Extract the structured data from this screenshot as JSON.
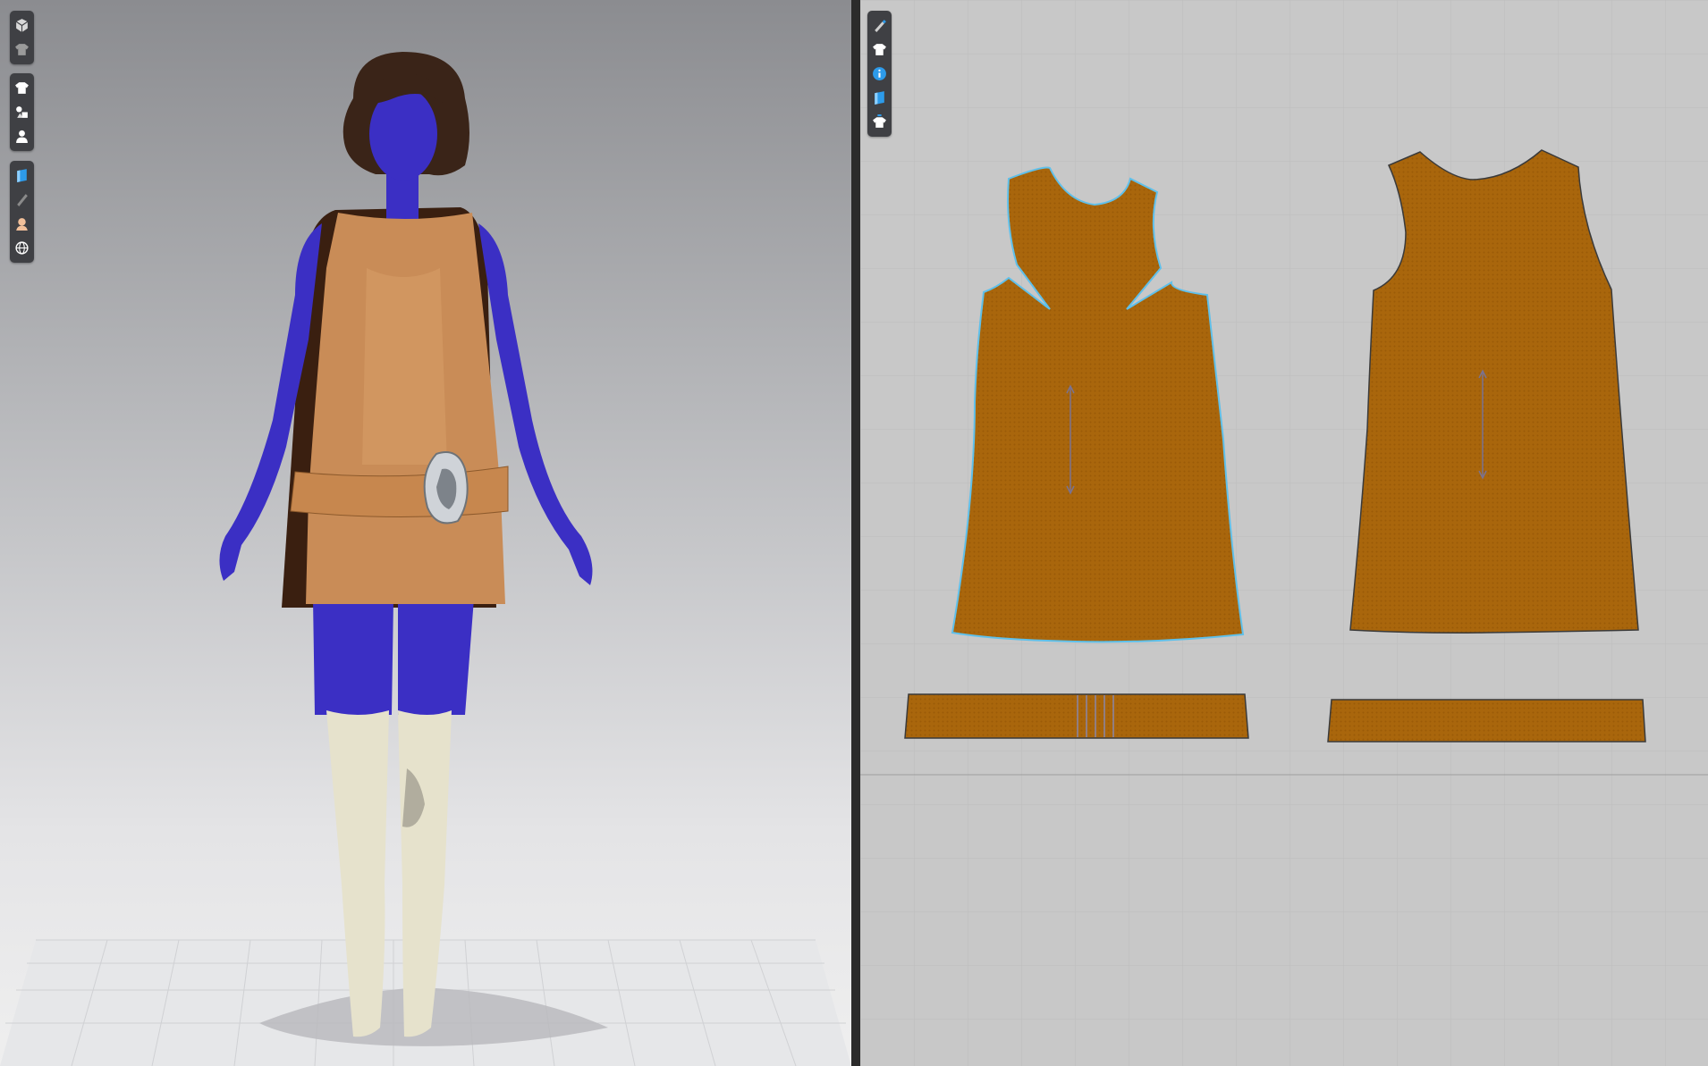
{
  "colors": {
    "fabric": "#a9660c",
    "fabric_3d": "#c98c57",
    "skin": "#3b2fc4",
    "boots": "#e6e2cc",
    "hair": "#3a2418",
    "buckle": "#cfd3d8",
    "seam_highlight": "#5fc0ea",
    "grid_floor": "#d9dadd",
    "toolbar_bg": "#3f4044"
  },
  "view3d_toolbar": {
    "groups": [
      [
        "cube-view-icon",
        "garment-hide-icon"
      ],
      [
        "shirt-icon",
        "shapes-icon",
        "avatar-icon"
      ],
      [
        "texture-icon",
        "ruler-icon",
        "skin-icon",
        "globe-icon"
      ]
    ]
  },
  "view2d_toolbar": {
    "tools": [
      "edit-pattern-icon",
      "shirt-icon",
      "info-icon",
      "texture-icon",
      "arrange-icon"
    ]
  },
  "patterns": [
    "front-bodice",
    "back-bodice",
    "front-belt",
    "back-belt"
  ]
}
